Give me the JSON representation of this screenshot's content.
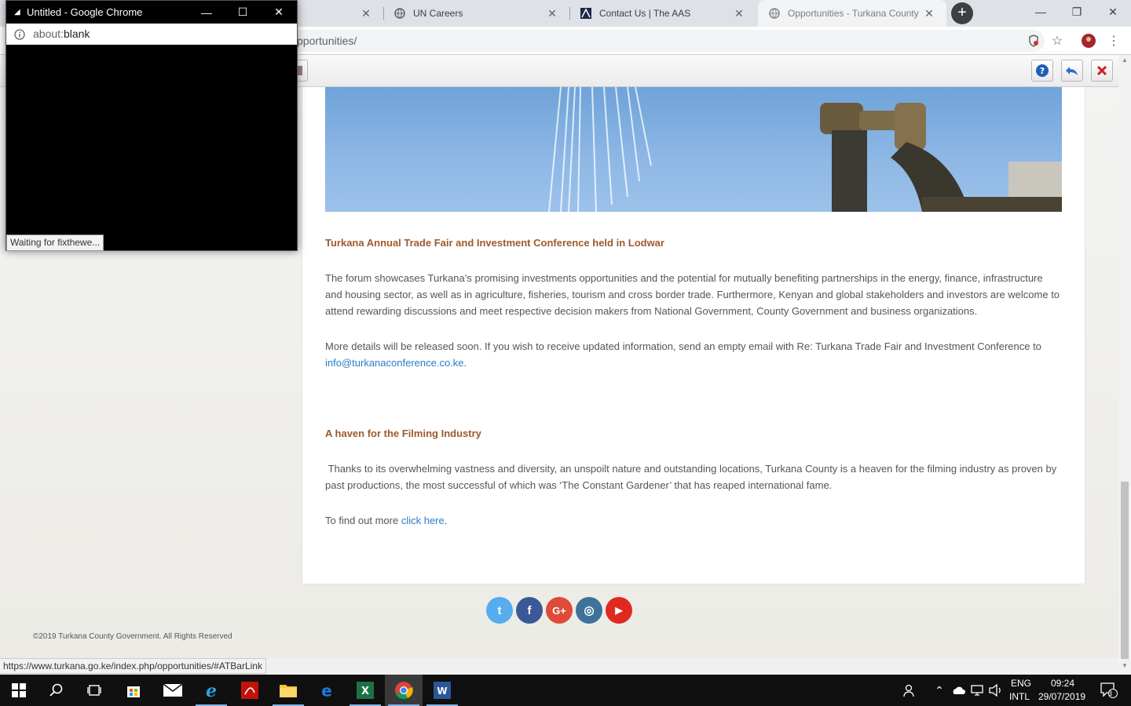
{
  "browser": {
    "tabs": [
      {
        "title": "",
        "active": false
      },
      {
        "title": "UN Careers",
        "active": false
      },
      {
        "title": "Contact Us | The AAS",
        "active": false
      },
      {
        "title": "Opportunities - Turkana County",
        "active": true
      }
    ],
    "url_suffix": "pportunities/"
  },
  "popup": {
    "title": "Untitled - Google Chrome",
    "url_prefix": "about:",
    "url_main": "blank",
    "status": "Waiting for fixthewe..."
  },
  "article": {
    "section1_title": "Turkana Annual Trade Fair and Investment Conference held in Lodwar",
    "section1_p1": "The forum showcases Turkana’s promising investments opportunities and the potential for mutually benefiting partnerships in the energy, finance, infrastructure and housing sector, as well as in agriculture, fisheries, tourism and cross border trade. Furthermore, Kenyan and global stakeholders and investors are welcome to attend rewarding discussions and meet respective decision makers from National Government, County Government and business organizations.",
    "section1_p2_text": "More details will be released soon. If you wish to receive updated information, send an empty email with Re: Turkana Trade Fair and Investment Conference to ",
    "section1_p2_link": "info@turkanaconference.co.ke",
    "section1_p2_end": ".",
    "section2_title": "A haven for the Filming Industry",
    "section2_p1": " Thanks to its overwhelming vastness and diversity, an unspoilt nature and outstanding locations, Turkana County is a heaven for the filming industry as proven by past productions, the most successful of which was ‘The Constant Gardener’ that has reaped international fame.",
    "section2_p2_text": "To find out more ",
    "section2_p2_link": "click here",
    "section2_p2_end": "."
  },
  "social": [
    {
      "name": "twitter",
      "glyph": "t",
      "color": "#55acee"
    },
    {
      "name": "facebook",
      "glyph": "f",
      "color": "#3b5998"
    },
    {
      "name": "google-plus",
      "glyph": "G+",
      "color": "#dd4b39"
    },
    {
      "name": "instagram",
      "glyph": "◎",
      "color": "#3f729b"
    },
    {
      "name": "youtube",
      "glyph": "▶",
      "color": "#e02a20"
    }
  ],
  "footer": {
    "copyright": "©2019 Turkana County Government. All Rights Reserved"
  },
  "status_url": "https://www.turkana.go.ke/index.php/opportunities/#ATBarLink",
  "taskbar": {
    "lang_top": "ENG",
    "lang_bottom": "INTL",
    "time": "09:24",
    "date": "29/07/2019",
    "notifications": "3"
  },
  "colors": {
    "heading": "#9c5a2c",
    "link": "#2a7cc7",
    "body_text": "#555555"
  }
}
